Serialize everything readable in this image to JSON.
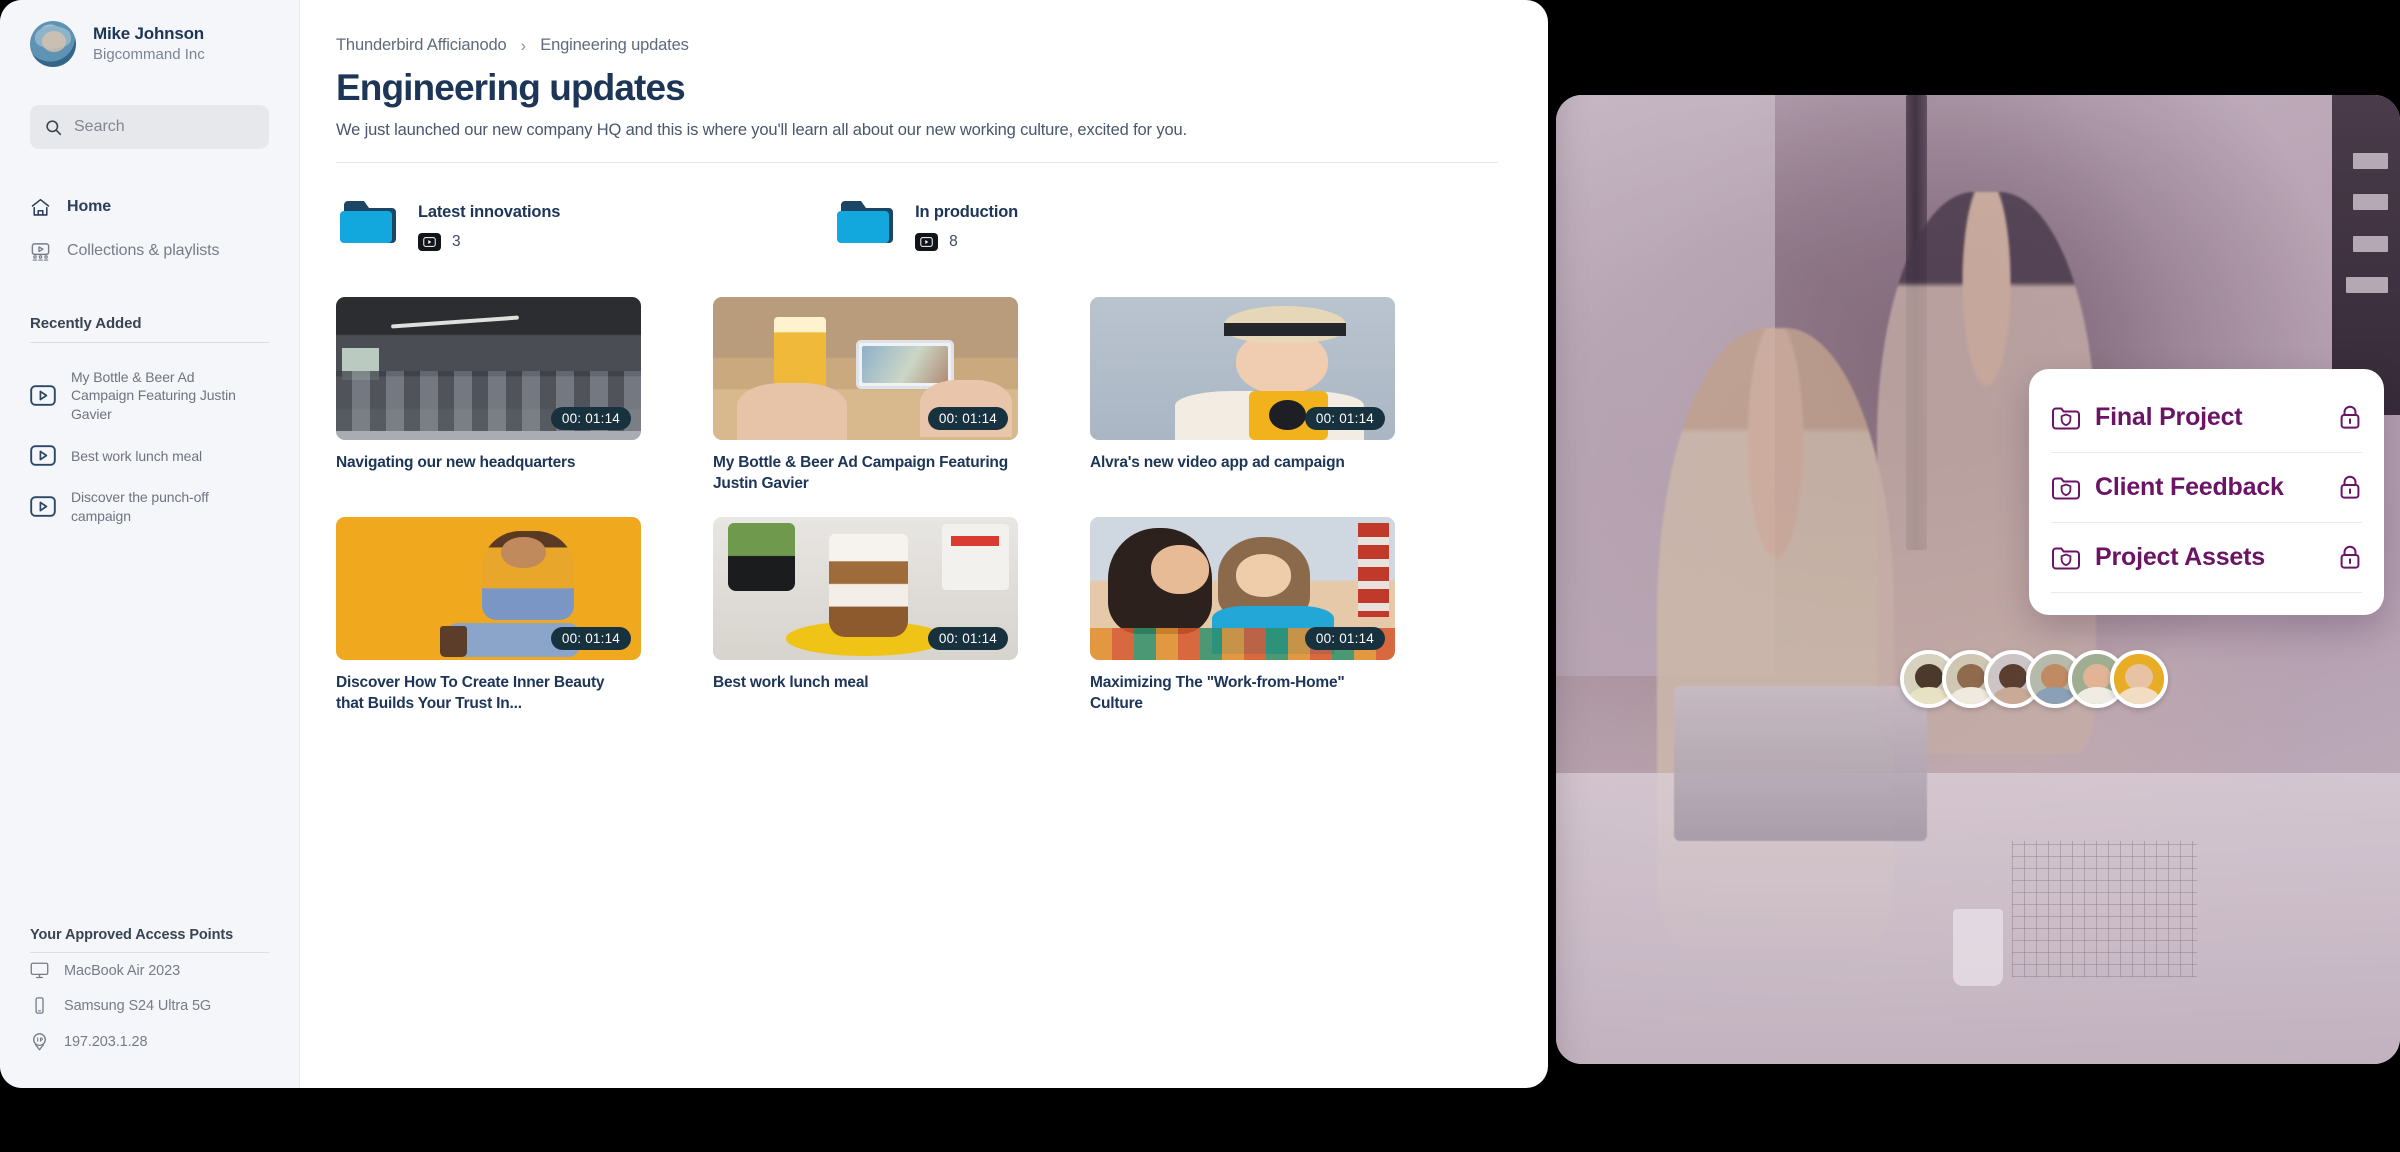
{
  "sidebar": {
    "profile": {
      "name": "Mike Johnson",
      "org": "Bigcommand Inc",
      "avatar_icon": "user-avatar"
    },
    "search": {
      "placeholder": "Search",
      "value": "",
      "icon": "search-icon"
    },
    "nav": [
      {
        "label": "Home",
        "icon": "home-icon",
        "active": true
      },
      {
        "label": "Collections & playlists",
        "icon": "collections-icon",
        "active": false
      }
    ],
    "recently_added": {
      "heading": "Recently Added",
      "items": [
        {
          "title": "My Bottle & Beer Ad Campaign Featuring Justin Gavier",
          "icon": "video-play-icon"
        },
        {
          "title": "Best work lunch meal",
          "icon": "video-play-icon"
        },
        {
          "title": "Discover the punch-off campaign",
          "icon": "video-play-icon"
        }
      ]
    },
    "access_points": {
      "heading": "Your Approved Access Points",
      "items": [
        {
          "label": "MacBook Air 2023",
          "icon": "monitor-icon"
        },
        {
          "label": "Samsung S24 Ultra 5G",
          "icon": "phone-icon"
        },
        {
          "label": "197.203.1.28",
          "icon": "ip-location-icon"
        }
      ]
    }
  },
  "main": {
    "breadcrumb": {
      "root": "Thunderbird Afficianodo",
      "separator": "›",
      "current": "Engineering updates"
    },
    "title": "Engineering updates",
    "subtitle": "We just launched our new company HQ and this is where you'll learn all about our new working culture, excited for you.",
    "folders": [
      {
        "name": "Latest innovations",
        "count": "3",
        "icon": "folder-icon",
        "badge_icon": "video-badge-icon"
      },
      {
        "name": "In production",
        "count": "8",
        "icon": "folder-icon",
        "badge_icon": "video-badge-icon"
      }
    ],
    "videos": [
      {
        "title": "Navigating our new headquarters",
        "duration": "00: 01:14",
        "thumb": "office-open-plan"
      },
      {
        "title": "My Bottle & Beer Ad Campaign Featuring Justin Gavier",
        "duration": "00: 01:14",
        "thumb": "beer-phone"
      },
      {
        "title": "Alvra's new video app ad campaign",
        "duration": "00: 01:14",
        "thumb": "woman-camera"
      },
      {
        "title": "Discover How To Create Inner Beauty that Builds Your Trust In...",
        "duration": "00: 01:14",
        "thumb": "woman-yellow-phone"
      },
      {
        "title": "Best work lunch meal",
        "duration": "00: 01:14",
        "thumb": "parfait-food"
      },
      {
        "title": "Maximizing The \"Work-from-Home\" Culture",
        "duration": "00: 01:14",
        "thumb": "mother-child-reading"
      }
    ]
  },
  "overlay": {
    "folders": [
      {
        "name": "Final Project",
        "folder_icon": "folder-shield-icon",
        "lock_icon": "lock-icon"
      },
      {
        "name": "Client Feedback",
        "folder_icon": "folder-shield-icon",
        "lock_icon": "lock-icon"
      },
      {
        "name": "Project Assets",
        "folder_icon": "folder-shield-icon",
        "lock_icon": "lock-icon"
      }
    ],
    "avatars": [
      {
        "name": "member-1"
      },
      {
        "name": "member-2"
      },
      {
        "name": "member-3"
      },
      {
        "name": "member-4"
      },
      {
        "name": "member-5"
      },
      {
        "name": "member-6"
      }
    ]
  },
  "colors": {
    "accent_blue": "#12a7dd",
    "folder_dark": "#1d4664",
    "title_navy": "#1d3557",
    "purple": "#6b1465",
    "duration_chip": "#17313f"
  }
}
